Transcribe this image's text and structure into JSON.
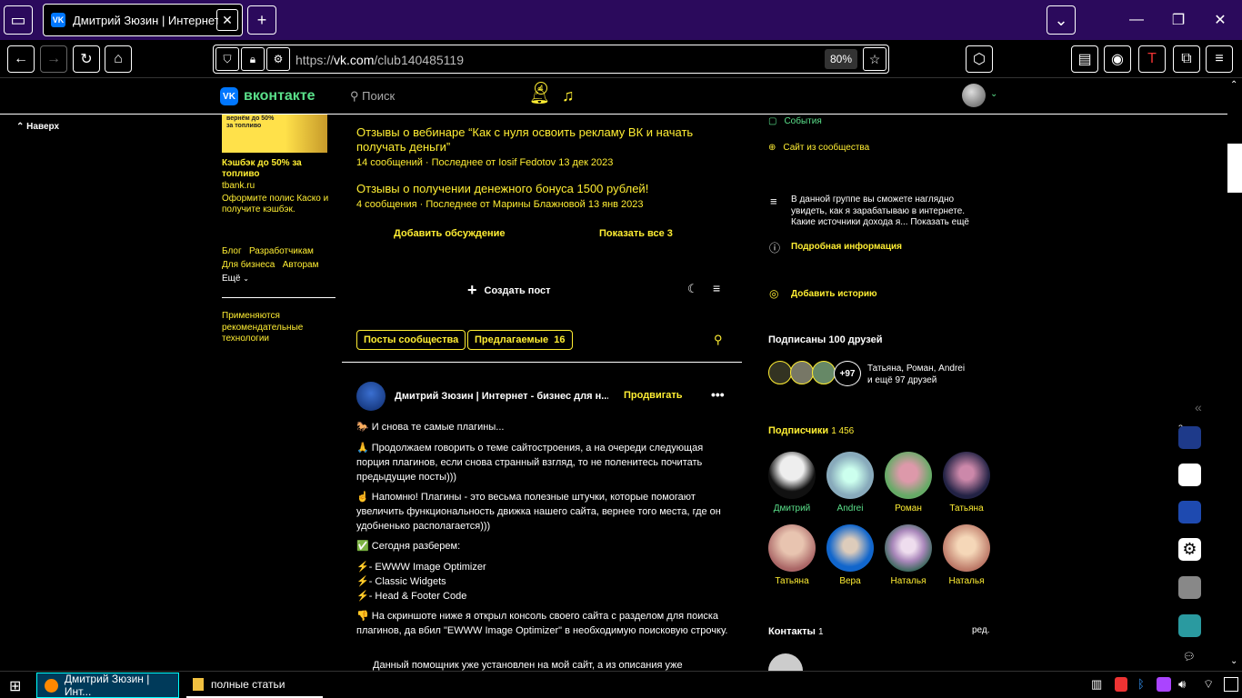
{
  "browser": {
    "tab_title": "Дмитрий Зюзин | Интернет -",
    "url_prefix": "https://",
    "url_domain": "vk.com",
    "url_path": "/club140485119",
    "zoom": "80%"
  },
  "vk": {
    "logo_text": "вконтакте",
    "search_placeholder": "Поиск",
    "notif_count": "4"
  },
  "left": {
    "back_top": "Наверх",
    "ad_banner_line1": "вернём до 50%",
    "ad_banner_line2": "за топливо",
    "ad_title": "Кэшбэк до 50% за топливо",
    "ad_domain": "tbank.ru",
    "ad_text": "Оформите полис Каско и получите кэшбэк.",
    "links_row1": [
      "Блог",
      "Разработчикам"
    ],
    "links_row2": [
      "Для бизнеса",
      "Авторам"
    ],
    "more": "Ещё",
    "rec_tech": "Применяются рекомендательные технологии"
  },
  "discussions": [
    {
      "title": "Отзывы о вебинаре “Как с нуля освоить рекламу ВК и начать получать деньги”",
      "meta": "14 сообщений · Последнее от Iosif Fedotov 13 дек 2023"
    },
    {
      "title": "Отзывы о получении денежного бонуса 1500 рублей!",
      "meta": "4 сообщения · Последнее от Марины Блажновой 13 янв 2023"
    }
  ],
  "disc_actions": {
    "add": "Добавить обсуждение",
    "show_all": "Показать все 3"
  },
  "create_post": "Создать пост",
  "tabs": {
    "community": "Посты сообщества",
    "suggested": "Предлагаемые",
    "suggested_count": "16"
  },
  "post": {
    "author": "Дмитрий Зюзин | Интернет - бизнес для н...",
    "promote": "Продвигать",
    "paragraphs": [
      "🐎 И снова те самые плагины...",
      "🙏 Продолжаем говорить о теме сайтостроения, а на очереди следующая порция плагинов, если снова странный взгляд, то не поленитесь почитать предыдущие посты)))",
      "☝ Напомню! Плагины - это весьма полезные штучки, которые помогают увеличить функциональность движка нашего сайта, вернее того места, где он удобненько располагается)))",
      "✅ Сегодня разберем:"
    ],
    "list": [
      "⚡- EWWW Image Optimizer",
      "⚡- Classic Widgets",
      "⚡- Head & Footer Code"
    ],
    "para_after": "👎 На скриншоте ниже я открыл консоль своего сайта с разделом для поиска плагинов, да вбил \"EWWW Image Optimizer\" в необходимую поисковую строчку.",
    "para_cut": "Данный помощник уже установлен на мой сайт, а из описания уже"
  },
  "right": {
    "events": "События",
    "site": "Сайт из сообщества",
    "description": "В данной группе вы сможете наглядно увидеть, как я зарабатываю в интернете. Какие источники дохода я... Показать ещё",
    "details": "Подробная информация",
    "add_story": "Добавить историю",
    "friends_title": "Подписаны 100 друзей",
    "friends_more": "+97",
    "friends_names": "Татьяна, Роман, Andrei",
    "friends_names2": "и ещё 97 друзей",
    "subs_title": "Подписчики",
    "subs_count": "1 456",
    "subscribers": [
      "Дмитрий",
      "Andrei",
      "Роман",
      "Татьяна",
      "Татьяна",
      "Вера",
      "Наталья",
      "Наталья"
    ],
    "contacts_title": "Контакты",
    "contacts_count": "1",
    "contacts_edit": "ред.",
    "side_badge": "3"
  },
  "taskbar": {
    "firefox_item": "Дмитрий Зюзин | Инт...",
    "folder_item": "полные статьи"
  },
  "colors": {
    "accent_yellow": "#ffee33",
    "accent_green": "#5ae08a",
    "tab_bg": "#2b0a5c",
    "vk_blue": "#0077ff"
  }
}
